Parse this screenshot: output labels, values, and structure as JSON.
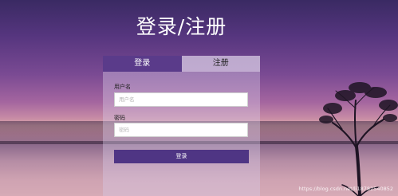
{
  "page": {
    "title": "登录/注册"
  },
  "tabs": [
    {
      "label": "登录",
      "active": true
    },
    {
      "label": "注册",
      "active": false
    }
  ],
  "form": {
    "username_label": "用户名",
    "username_placeholder": "用户名",
    "password_label": "密码",
    "password_placeholder": "密码",
    "submit_label": "登录"
  },
  "watermark": "https://blog.csdn.net/li18782540852",
  "colors": {
    "accent": "#5a3b8a",
    "button": "#4f3584"
  }
}
